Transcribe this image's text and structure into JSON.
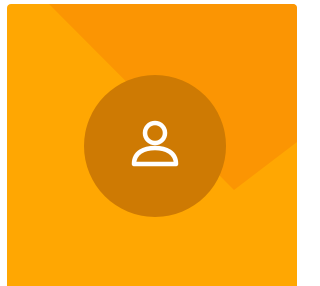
{
  "avatar": {
    "icon": "person-outline-icon",
    "colors": {
      "tile_background": "#FFA702",
      "diagonal_accent": "#FB9503",
      "circle_background": "#CE7A03",
      "icon_stroke": "#FFFFFF"
    }
  }
}
